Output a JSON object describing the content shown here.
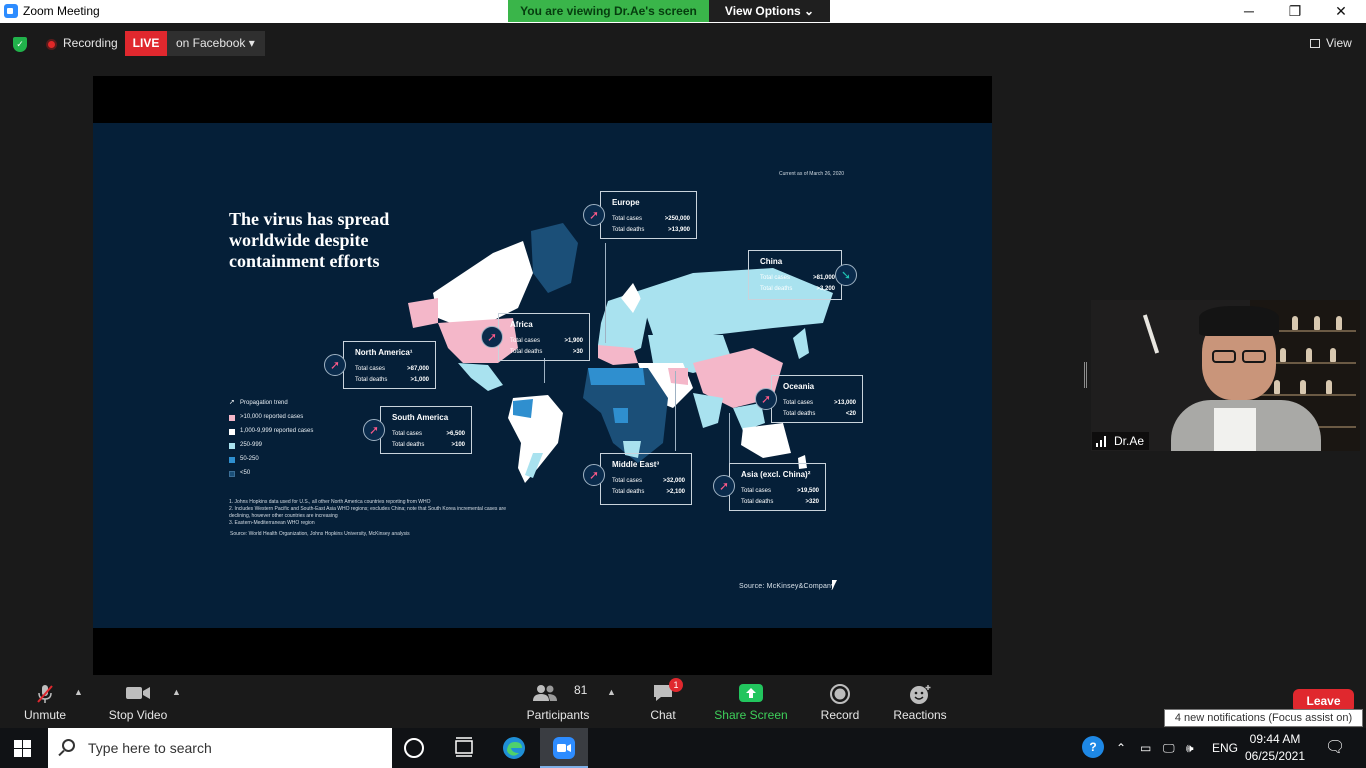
{
  "window": {
    "title": "Zoom Meeting",
    "minimize": "─",
    "restore": "❐",
    "close": "✕"
  },
  "banner": {
    "viewing": "You are viewing Dr.Ae's screen",
    "view_options": "View Options ⌄"
  },
  "topbar": {
    "recording": "Recording",
    "live": "LIVE",
    "live_dest": "on Facebook ▾",
    "view": "View"
  },
  "slide": {
    "headline": "The virus has spread worldwide despite containment efforts",
    "as_of": "Current as of March 26, 2020",
    "source_brand": "Source: McKinsey&Company",
    "legend": [
      {
        "label": "Propagation trend",
        "color": ""
      },
      {
        "label": ">10,000 reported cases",
        "color": "#f4b7c9"
      },
      {
        "label": "1,000-9,999 reported cases",
        "color": "#ffffff"
      },
      {
        "label": "250-999",
        "color": "#a9e2ef"
      },
      {
        "label": "50-250",
        "color": "#2f8fcf"
      },
      {
        "label": "<50",
        "color": "#1b4f78"
      }
    ],
    "footnotes": [
      "1. Johns Hopkins data used for U.S., all other North America countries reporting from WHO",
      "2. Includes Western Pacific and South-East Asia WHO regions; excludes China; note that South Korea incremental cases are",
      "    declining, however other countries are increasing",
      "3. Eastern-Mediterranean WHO region"
    ],
    "footnote_source": "Source: World Health Organization, Johns Hopkins University, McKinsey analysis",
    "total_cases_label": "Total cases",
    "total_deaths_label": "Total deaths",
    "regions": {
      "europe": {
        "name": "Europe",
        "cases": ">250,000",
        "deaths": ">13,900",
        "trend": "up"
      },
      "china": {
        "name": "China",
        "cases": ">81,000",
        "deaths": ">3,200",
        "trend": "down"
      },
      "africa": {
        "name": "Africa",
        "cases": ">1,900",
        "deaths": ">30",
        "trend": "up"
      },
      "north_america": {
        "name": "North America¹",
        "cases": ">87,000",
        "deaths": ">1,000",
        "trend": "up"
      },
      "oceania": {
        "name": "Oceania",
        "cases": ">13,000",
        "deaths": "<20",
        "trend": "up"
      },
      "south_america": {
        "name": "South America",
        "cases": ">6,500",
        "deaths": ">100",
        "trend": "up"
      },
      "middle_east": {
        "name": "Middle East³",
        "cases": ">32,000",
        "deaths": ">2,100",
        "trend": "up"
      },
      "asia": {
        "name": "Asia (excl. China)²",
        "cases": ">19,500",
        "deaths": ">320",
        "trend": "up"
      }
    }
  },
  "participant": {
    "name": "Dr.Ae"
  },
  "toolbar": {
    "unmute": "Unmute",
    "stop_video": "Stop Video",
    "participants": "Participants",
    "participants_count": "81",
    "chat": "Chat",
    "chat_badge": "1",
    "share_screen": "Share Screen",
    "record": "Record",
    "reactions": "Reactions",
    "leave": "Leave"
  },
  "notification": "4 new notifications (Focus assist on)",
  "taskbar": {
    "search_placeholder": "Type here to search",
    "lang": "ENG",
    "time": "09:44 AM",
    "date": "06/25/2021"
  },
  "colors": {
    "live_red": "#e0282e",
    "share_green": "#3ab54a",
    "slide_navy": "#051f38"
  }
}
